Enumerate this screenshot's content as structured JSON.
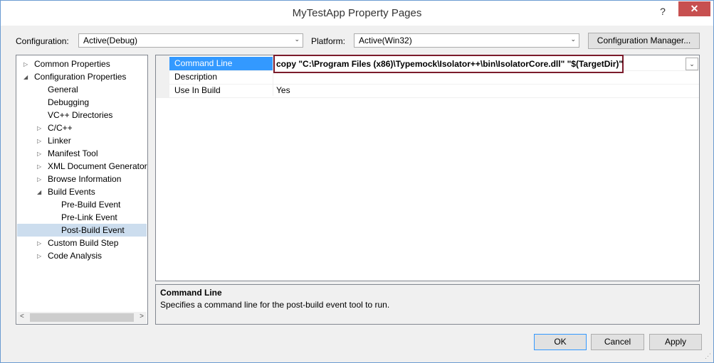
{
  "window": {
    "title": "MyTestApp Property Pages",
    "help": "?",
    "close": "✕"
  },
  "config": {
    "label": "Configuration:",
    "value": "Active(Debug)",
    "arrow": "⌄"
  },
  "platform": {
    "label": "Platform:",
    "value": "Active(Win32)",
    "arrow": "⌄"
  },
  "config_manager": {
    "label": "Configuration Manager..."
  },
  "tree": {
    "items": [
      {
        "label": "Common Properties",
        "tri": "▷"
      },
      {
        "label": "Configuration Properties",
        "tri": "◢"
      },
      {
        "label": "General"
      },
      {
        "label": "Debugging"
      },
      {
        "label": "VC++ Directories"
      },
      {
        "label": "C/C++",
        "tri": "▷"
      },
      {
        "label": "Linker",
        "tri": "▷"
      },
      {
        "label": "Manifest Tool",
        "tri": "▷"
      },
      {
        "label": "XML Document Generator",
        "tri": "▷"
      },
      {
        "label": "Browse Information",
        "tri": "▷"
      },
      {
        "label": "Build Events",
        "tri": "◢"
      },
      {
        "label": "Pre-Build Event"
      },
      {
        "label": "Pre-Link Event"
      },
      {
        "label": "Post-Build Event",
        "selected": true
      },
      {
        "label": "Custom Build Step",
        "tri": "▷"
      },
      {
        "label": "Code Analysis",
        "tri": "▷"
      }
    ],
    "scroll_left": "<",
    "scroll_right": ">"
  },
  "grid": {
    "rows": [
      {
        "name": "Command Line",
        "value": "copy \"C:\\Program Files (x86)\\Typemock\\Isolator++\\bin\\IsolatorCore.dll\" \"$(TargetDir)\""
      },
      {
        "name": "Description",
        "value": ""
      },
      {
        "name": "Use In Build",
        "value": "Yes"
      }
    ],
    "dropdown": "⌄"
  },
  "description": {
    "title": "Command Line",
    "text": "Specifies a command line for the post-build event tool to run."
  },
  "buttons": {
    "ok": "OK",
    "cancel": "Cancel",
    "apply": "Apply"
  },
  "colors": {
    "selection": "#3399ff",
    "highlight_border": "#7b1b2b",
    "close": "#c75050"
  }
}
